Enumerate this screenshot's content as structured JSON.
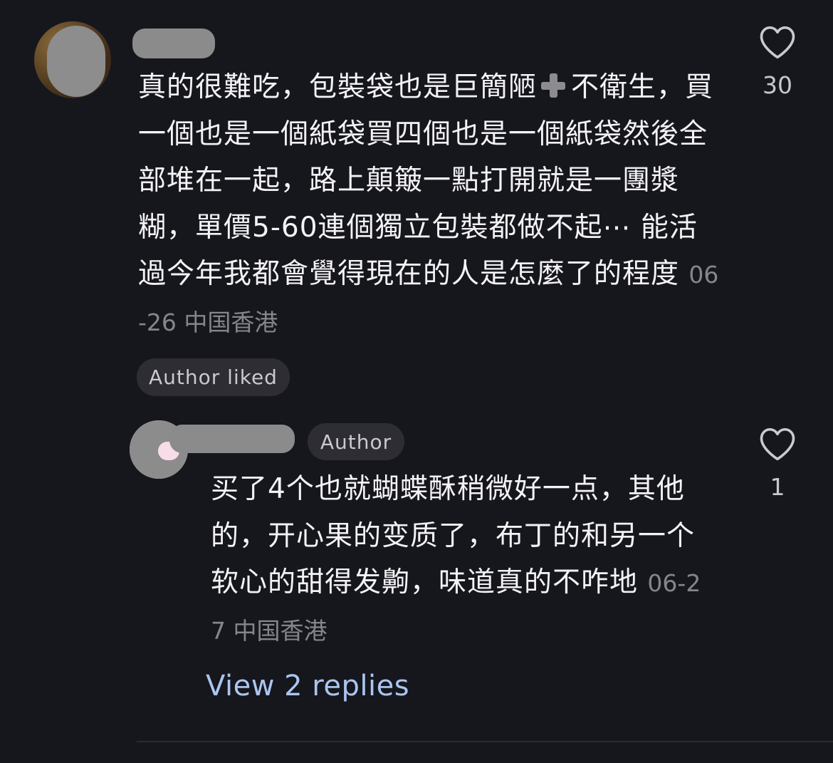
{
  "comment": {
    "text": "真的很難吃，包裝袋也是巨簡陋",
    "text_emoji": "heavy-plus-emoji",
    "text_after": "不衛生，買一個也是一個紙袋買四個也是一個紙袋然後全部堆在一起，路上顛簸一點打開就是一團漿糊，單價5-60連個獨立包裝都做不起⋯ 能活過今年我都會覺得現在的人是怎麼了的程度",
    "date": "06-26",
    "location": "中国香港",
    "badge": "Author liked",
    "likes": "30"
  },
  "reply": {
    "author_tag": "Author",
    "text": "买了4个也就蝴蝶酥稍微好一点，其他的，开心果的变质了，布丁的和另一个软心的甜得发齁，味道真的不咋地",
    "date": "06-27",
    "location": "中国香港",
    "likes": "1"
  },
  "view_replies": "View 2 replies",
  "colors": {
    "background": "#16161d",
    "text": "#f3f3f5",
    "meta": "#85858d",
    "link": "#aac6ef",
    "pill_bg": "#2d2d33"
  },
  "icons": {
    "like": "heart-outline-icon"
  }
}
